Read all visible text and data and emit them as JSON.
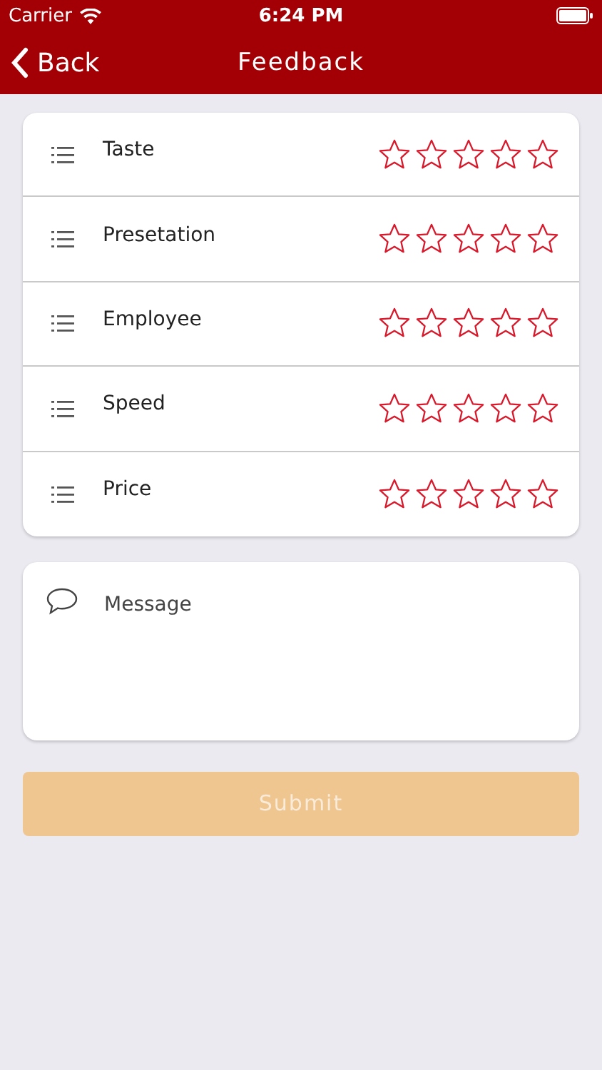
{
  "status_bar": {
    "carrier": "Carrier",
    "time": "6:24 PM"
  },
  "nav": {
    "back": "Back",
    "title": "Feedback"
  },
  "ratings": [
    {
      "label": "Taste",
      "stars": 0
    },
    {
      "label": "Presetation",
      "stars": 0
    },
    {
      "label": "Employee",
      "stars": 0
    },
    {
      "label": "Speed",
      "stars": 0
    },
    {
      "label": "Price",
      "stars": 0
    }
  ],
  "message": {
    "placeholder": "Message"
  },
  "submit": {
    "label": "Submit",
    "disabled": true
  }
}
